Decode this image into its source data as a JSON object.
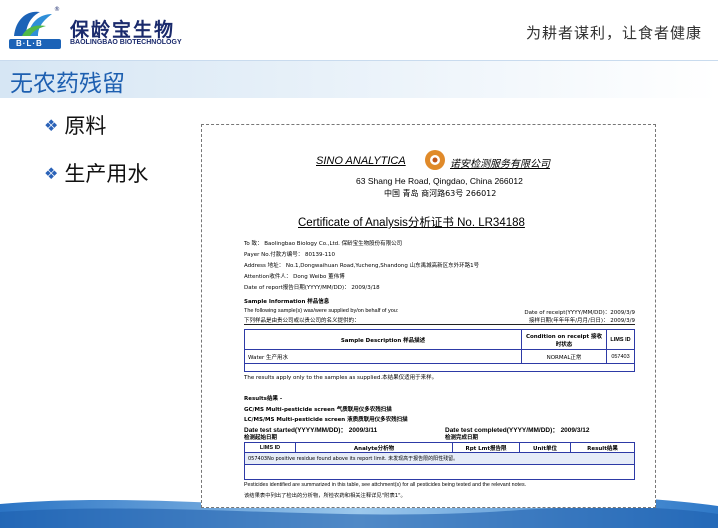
{
  "header": {
    "logo_zh": "保龄宝生物",
    "logo_en": "BAOLINGBAO BIOTECHNOLOGY",
    "logo_badge": "B·L·B",
    "slogan": "为耕者谋利，让食者健康"
  },
  "slide": {
    "title": "无农药残留",
    "bullets": [
      "原料",
      "生产用水"
    ]
  },
  "document": {
    "lab_name": "SINO ANALYTICA",
    "lab_name_zh": "诺安检测服务有限公司",
    "address_en": "63 Shang He Road, Qingdao, China 266012",
    "address_zh": "中国 青岛 商河路63号 266012",
    "certificate_title": "Certificate of Analysis分析证书 No. LR34188",
    "fields": {
      "to": "To 致：  Baolingbao Biology Co.,Ltd. 保龄宝生物股份有限公司",
      "payer": "Payer No.付款方编号：   80139-110",
      "address": "Address 地址：  No.1,Dongwaihuan Road,Yucheng,Shandong 山东禹城高新区东外环路1号",
      "attention": "Attention收件人：   Dong Weibo 董伟博",
      "report_date": "Date of report报告日期(YYYY/MM/DD)：    2009/3/18"
    },
    "sample_info_heading": "Sample Information 样品信息",
    "sample_info_line1": "The following sample(s) was/were supplied by/on behalf of you:",
    "sample_info_line2": "下列样品是由贵公司或以贵公司的名义提供的：",
    "receipt_date": "Date of receipt(YYYY/MM/DD)：2009/3/9",
    "received_date": "接样日期(年年年年/月月/日日)：   2009/3/9",
    "sample_table": {
      "headers": [
        "Sample Description 样品描述",
        "Condition on receipt 接收时状态",
        "LIMS ID"
      ],
      "rows": [
        [
          "Water 生产用水",
          "NORMAL正常",
          "057403"
        ]
      ]
    },
    "results_apply": "The results apply only to the samples as supplied.本结果仅适用于来样。",
    "results_heading": "Results结果 -",
    "gc_screen": "GC/MS Multi-pesticide screen  气质联用仪多农残扫描",
    "lc_screen": "LC/MS/MS Multi-pesticide screen  液质质联用仪多农残扫描",
    "test_started": "Date test started(YYYY/MM/DD)：        2009/3/11",
    "test_started_zh": "检测起始日期",
    "test_completed": "Date test completed(YYYY/MM/DD)：     2009/3/12",
    "test_completed_zh": "检测完成日期",
    "results_table": {
      "headers": [
        "LIMS ID",
        "Analyte分析物",
        "Rpt Lmt报告限",
        "Unit单位",
        "Result结果"
      ],
      "row_text": "057403No positive residue found above its report limit.  未发现高于报告限的阳性残留。"
    },
    "footnote1": "Pesticides identified are summarized in this table, see attchment(s) for all pesticides being tested and the relevant notes.",
    "footnote2": "该结果表中列出了检出的分析物，所检农药和相关注释详见\"附表1\"。"
  },
  "colors": {
    "title": "#1d5fb0",
    "bullet_diamond": "#2a62b8",
    "table_border": "#2d3aa6",
    "logo_text": "#1a2a6c"
  }
}
